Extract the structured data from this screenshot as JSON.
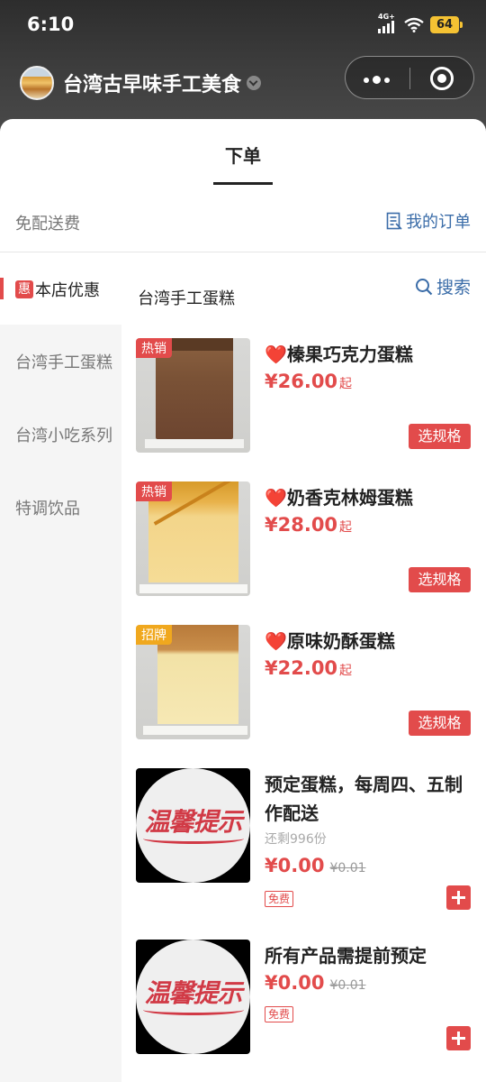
{
  "status_bar": {
    "time": "6:10",
    "network": "4G+",
    "battery": "64"
  },
  "header": {
    "shop_name": "台湾古早味手工美食"
  },
  "tabs": {
    "active": "下单"
  },
  "info_bar": {
    "free_delivery": "免配送费",
    "my_orders": "我的订单"
  },
  "sidebar": {
    "active_badge": "惠",
    "active_label": "本店优惠",
    "items": [
      "台湾手工蛋糕",
      "台湾小吃系列",
      "特调饮品"
    ]
  },
  "content": {
    "category_title": "台湾手工蛋糕",
    "search_label": "搜索",
    "products": [
      {
        "badge": "热销",
        "heart": "❤️",
        "name": "榛果巧克力蛋糕",
        "price": "¥26.00",
        "suffix": "起",
        "button": "选规格"
      },
      {
        "badge": "热销",
        "heart": "❤️",
        "name": "奶香克林姆蛋糕",
        "price": "¥28.00",
        "suffix": "起",
        "button": "选规格"
      },
      {
        "badge": "招牌",
        "heart": "❤️",
        "name": "原味奶酥蛋糕",
        "price": "¥22.00",
        "suffix": "起",
        "button": "选规格"
      },
      {
        "name": "预定蛋糕，每周四、五制作配送",
        "remaining": "还剩996份",
        "price": "¥0.00",
        "original_price": "¥0.01",
        "tag": "免费",
        "image_text": "温馨提示"
      },
      {
        "name": "所有产品需提前预定",
        "price": "¥0.00",
        "original_price": "¥0.01",
        "tag": "免费",
        "image_text": "温馨提示"
      }
    ]
  },
  "colors": {
    "accent": "#e24b4b",
    "link": "#3a6ca8",
    "badge_gold": "#f0a81e"
  }
}
